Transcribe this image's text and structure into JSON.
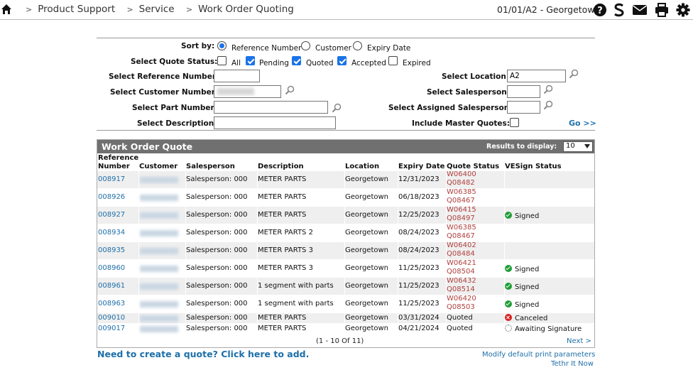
{
  "nav": {
    "breadcrumbs": [
      "Product Support",
      "Service",
      "Work Order Quoting"
    ],
    "location": "01/01/A2 - Georgetown",
    "icons": [
      "home-icon",
      "help-icon",
      "s-app-icon",
      "mail-icon",
      "print-icon",
      "settings-icon"
    ]
  },
  "filters": {
    "sort_label": "Sort by:",
    "sort_options": [
      "Reference Number",
      "Customer",
      "Expiry Date"
    ],
    "sort_selected": "Reference Number",
    "status_label": "Select Quote Status:",
    "status_options": [
      {
        "label": "All",
        "checked": false
      },
      {
        "label": "Pending",
        "checked": true
      },
      {
        "label": "Quoted",
        "checked": true
      },
      {
        "label": "Accepted",
        "checked": true
      },
      {
        "label": "Expired",
        "checked": false
      }
    ],
    "reference_label": "Select Reference Number:",
    "reference_value": "",
    "customer_label": "Select Customer Number:",
    "part_label": "Select Part Number:",
    "part_value": "",
    "description_label": "Select Description:",
    "description_value": "",
    "location_label": "Select Location:",
    "location_value": "A2",
    "salesperson_label": "Select Salesperson:",
    "salesperson_value": "",
    "assigned_label": "Select Assigned Salesperson:",
    "assigned_value": "",
    "master_label": "Include Master Quotes:",
    "master_checked": false,
    "go_label": "Go >>"
  },
  "table": {
    "title": "Work Order Quote",
    "results_label": "Results to display:",
    "results_value": "10",
    "headers": [
      "Reference Number",
      "Customer",
      "Salesperson",
      "Description",
      "Location",
      "Expiry Date",
      "Quote Status",
      "VESign Status"
    ],
    "rows": [
      {
        "ref": "008917",
        "salesperson": "Salesperson: 000",
        "description": "METER PARTS",
        "location": "Georgetown",
        "expiry": "12/31/2023",
        "status": [
          "W06400",
          "Q08482"
        ],
        "vesign": "",
        "vesign_icon": ""
      },
      {
        "ref": "008926",
        "salesperson": "Salesperson: 000",
        "description": "METER PARTS",
        "location": "Georgetown",
        "expiry": "06/18/2023",
        "status": [
          "W06385",
          "Q08467"
        ],
        "vesign": "",
        "vesign_icon": ""
      },
      {
        "ref": "008927",
        "salesperson": "Salesperson: 000",
        "description": "METER PARTS",
        "location": "Georgetown",
        "expiry": "12/25/2023",
        "status": [
          "W06415",
          "Q08497"
        ],
        "vesign": "Signed",
        "vesign_icon": "check-circle-icon"
      },
      {
        "ref": "008934",
        "salesperson": "Salesperson: 000",
        "description": "METER PARTS 2",
        "location": "Georgetown",
        "expiry": "08/24/2023",
        "status": [
          "W06385",
          "Q08467"
        ],
        "vesign": "",
        "vesign_icon": ""
      },
      {
        "ref": "008935",
        "salesperson": "Salesperson: 000",
        "description": "METER PARTS 3",
        "location": "Georgetown",
        "expiry": "08/24/2023",
        "status": [
          "W06402",
          "Q08484"
        ],
        "vesign": "",
        "vesign_icon": ""
      },
      {
        "ref": "008960",
        "salesperson": "Salesperson: 000",
        "description": "METER PARTS 3",
        "location": "Georgetown",
        "expiry": "11/25/2023",
        "status": [
          "W06421",
          "Q08504"
        ],
        "vesign": "Signed",
        "vesign_icon": "check-circle-icon"
      },
      {
        "ref": "008961",
        "salesperson": "Salesperson: 000",
        "description": "1 segment with parts",
        "location": "Georgetown",
        "expiry": "11/25/2023",
        "status": [
          "W06432",
          "Q08514"
        ],
        "vesign": "Signed",
        "vesign_icon": "check-circle-icon"
      },
      {
        "ref": "008963",
        "salesperson": "Salesperson: 000",
        "description": "1 segment with parts",
        "location": "Georgetown",
        "expiry": "11/25/2023",
        "status": [
          "W06420",
          "Q08503"
        ],
        "vesign": "Signed",
        "vesign_icon": "check-circle-icon"
      },
      {
        "ref": "009010",
        "salesperson": "Salesperson: 000",
        "description": "METER PARTS",
        "location": "Georgetown",
        "expiry": "03/31/2024",
        "status": [
          "Quoted"
        ],
        "vesign": "Canceled",
        "vesign_icon": "cancel-circle-icon"
      },
      {
        "ref": "009017",
        "salesperson": "Salesperson: 000",
        "description": "METER PARTS",
        "location": "Georgetown",
        "expiry": "04/21/2024",
        "status": [
          "Quoted"
        ],
        "vesign": "Awaiting Signature",
        "vesign_icon": "pending-circle-icon"
      }
    ],
    "pager": "(1 - 10 Of 11)",
    "next_label": "Next >"
  },
  "footer": {
    "create_label": "Need to create a quote? Click here to add.",
    "print_params_label": "Modify default print parameters",
    "tethr_label": "Tethr It Now"
  },
  "colors": {
    "link": "#1e6fa8",
    "status_red": "#b0413e",
    "header_gray": "#707070",
    "row_shade": "#efefef"
  }
}
